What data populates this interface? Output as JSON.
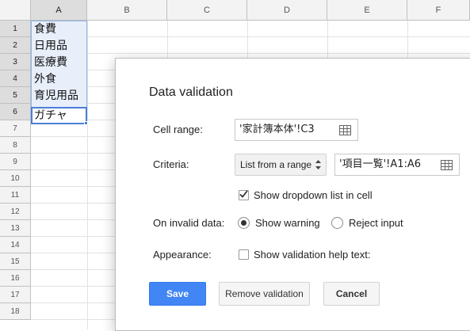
{
  "sheet": {
    "columns": [
      "A",
      "B",
      "C",
      "D",
      "E",
      "F"
    ],
    "rows": [
      "1",
      "2",
      "3",
      "4",
      "5",
      "6",
      "7",
      "8",
      "9",
      "10",
      "11",
      "12",
      "13",
      "14",
      "15",
      "16",
      "17",
      "18"
    ],
    "column_a_values": [
      "食費",
      "日用品",
      "医療費",
      "外食",
      "育児用品",
      "ガチャ"
    ]
  },
  "dialog": {
    "title": "Data validation",
    "cell_range": {
      "label": "Cell range:",
      "value": "'家計簿本体'!C3"
    },
    "criteria": {
      "label": "Criteria:",
      "type_selected": "List from a range",
      "range_value": "'項目一覧'!A1:A6"
    },
    "show_dropdown": {
      "label": "Show dropdown list in cell",
      "checked": true
    },
    "on_invalid": {
      "label": "On invalid data:",
      "options": [
        "Show warning",
        "Reject input"
      ],
      "selected": "Show warning"
    },
    "appearance": {
      "label": "Appearance:",
      "help_text_label": "Show validation help text:",
      "checked": false
    },
    "buttons": {
      "save": "Save",
      "remove": "Remove validation",
      "cancel": "Cancel"
    }
  },
  "colors": {
    "accent": "#4285f4",
    "selection_fill": "#e8effb",
    "selection_border": "#4a7fd8"
  }
}
